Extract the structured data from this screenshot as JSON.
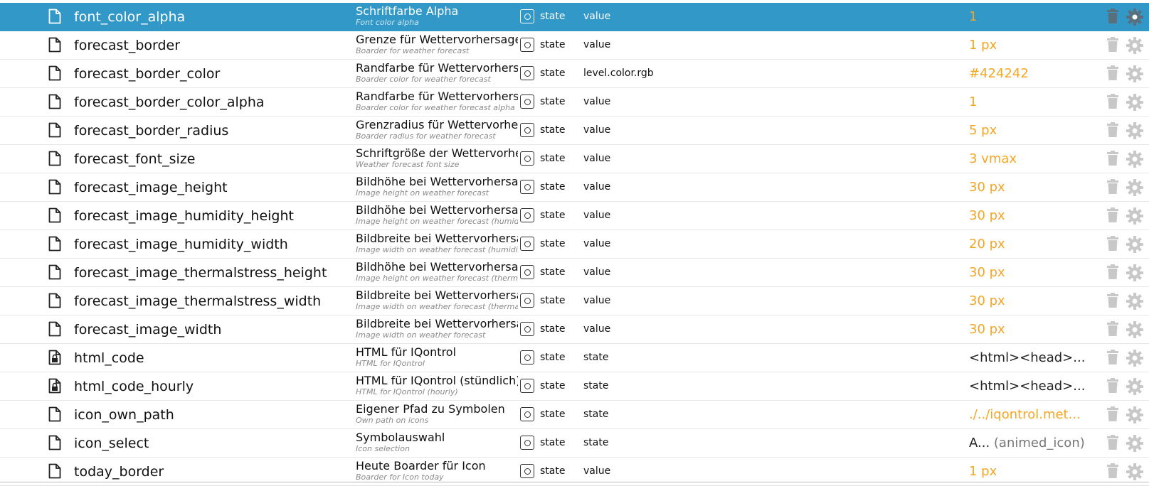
{
  "colors": {
    "selected_bg": "#3298c8",
    "value_orange": "#f5a623",
    "icon_gray": "#c8c8c8"
  },
  "rows": [
    {
      "icon": "file-icon",
      "name": "font_color_alpha",
      "desc": "Schriftfarbe Alpha",
      "desc_sub": "Font color alpha",
      "type": "state",
      "role": "value",
      "value": "1",
      "suffix": "",
      "value_style": "orange",
      "selected": true
    },
    {
      "icon": "file-icon",
      "name": "forecast_border",
      "desc": "Grenze für Wettervorhersage",
      "desc_sub": "Boarder for weather forecast",
      "type": "state",
      "role": "value",
      "value": "1 px",
      "suffix": "",
      "value_style": "orange"
    },
    {
      "icon": "file-icon",
      "name": "forecast_border_color",
      "desc": "Randfarbe für Wettervorhersa",
      "desc_sub": "Boarder color for weather forecast",
      "type": "state",
      "role": "level.color.rgb",
      "value": "#424242",
      "suffix": "",
      "value_style": "orange"
    },
    {
      "icon": "file-icon",
      "name": "forecast_border_color_alpha",
      "desc": "Randfarbe für Wettervorhersa",
      "desc_sub": "Boarder color for weather forecast alpha",
      "type": "state",
      "role": "value",
      "value": "1",
      "suffix": "",
      "value_style": "orange"
    },
    {
      "icon": "file-icon",
      "name": "forecast_border_radius",
      "desc": "Grenzradius für Wettervorhers",
      "desc_sub": "Boarder radius for weather forecast",
      "type": "state",
      "role": "value",
      "value": "5 px",
      "suffix": "",
      "value_style": "orange"
    },
    {
      "icon": "file-icon",
      "name": "forecast_font_size",
      "desc": "Schriftgröße der Wettervorher",
      "desc_sub": "Weather forecast font size",
      "type": "state",
      "role": "value",
      "value": "3 vmax",
      "suffix": "",
      "value_style": "orange"
    },
    {
      "icon": "file-icon",
      "name": "forecast_image_height",
      "desc": "Bildhöhe bei Wettervorhersag",
      "desc_sub": "Image height on weather forecast",
      "type": "state",
      "role": "value",
      "value": "30 px",
      "suffix": "",
      "value_style": "orange"
    },
    {
      "icon": "file-icon",
      "name": "forecast_image_humidity_height",
      "desc": "Bildhöhe bei Wettervorhersag",
      "desc_sub": "Image height on weather forecast (humidit",
      "type": "state",
      "role": "value",
      "value": "30 px",
      "suffix": "",
      "value_style": "orange"
    },
    {
      "icon": "file-icon",
      "name": "forecast_image_humidity_width",
      "desc": "Bildbreite bei Wettervorhersag",
      "desc_sub": "Image width on weather forecast (humidity",
      "type": "state",
      "role": "value",
      "value": "20 px",
      "suffix": "",
      "value_style": "orange"
    },
    {
      "icon": "file-icon",
      "name": "forecast_image_thermalstress_height",
      "desc": "Bildhöhe bei Wettervorhersag",
      "desc_sub": "Image height on weather forecast (thermal",
      "type": "state",
      "role": "value",
      "value": "30 px",
      "suffix": "",
      "value_style": "orange"
    },
    {
      "icon": "file-icon",
      "name": "forecast_image_thermalstress_width",
      "desc": "Bildbreite bei Wettervorhersag",
      "desc_sub": "Image width on weather forecast (thermals",
      "type": "state",
      "role": "value",
      "value": "30 px",
      "suffix": "",
      "value_style": "orange"
    },
    {
      "icon": "file-icon",
      "name": "forecast_image_width",
      "desc": "Bildbreite bei Wettervorhersag",
      "desc_sub": "Image width on weather forecast",
      "type": "state",
      "role": "value",
      "value": "30 px",
      "suffix": "",
      "value_style": "orange"
    },
    {
      "icon": "locked-file-icon",
      "name": "html_code",
      "desc": "HTML für IQontrol",
      "desc_sub": "HTML for IQontrol",
      "type": "state",
      "role": "state",
      "value": "<html><head>...",
      "suffix": "",
      "value_style": "dark"
    },
    {
      "icon": "locked-file-icon",
      "name": "html_code_hourly",
      "desc": "HTML für IQontrol (stündlich)",
      "desc_sub": "HTML for IQontrol (hourly)",
      "type": "state",
      "role": "state",
      "value": "<html><head>...",
      "suffix": "",
      "value_style": "dark"
    },
    {
      "icon": "file-icon",
      "name": "icon_own_path",
      "desc": "Eigener Pfad zu Symbolen",
      "desc_sub": "Own path on icons",
      "type": "state",
      "role": "state",
      "value": "./../iqontrol.met...",
      "suffix": "",
      "value_style": "orange"
    },
    {
      "icon": "file-icon",
      "name": "icon_select",
      "desc": "Symbolauswahl",
      "desc_sub": "Icon selection",
      "type": "state",
      "role": "state",
      "value": "A...",
      "suffix": "(animed_icon)",
      "value_style": "dark"
    },
    {
      "icon": "file-icon",
      "name": "today_border",
      "desc": "Heute Boarder für Icon",
      "desc_sub": "Boarder for Icon today",
      "type": "state",
      "role": "value",
      "value": "1 px",
      "suffix": "",
      "value_style": "orange"
    }
  ]
}
